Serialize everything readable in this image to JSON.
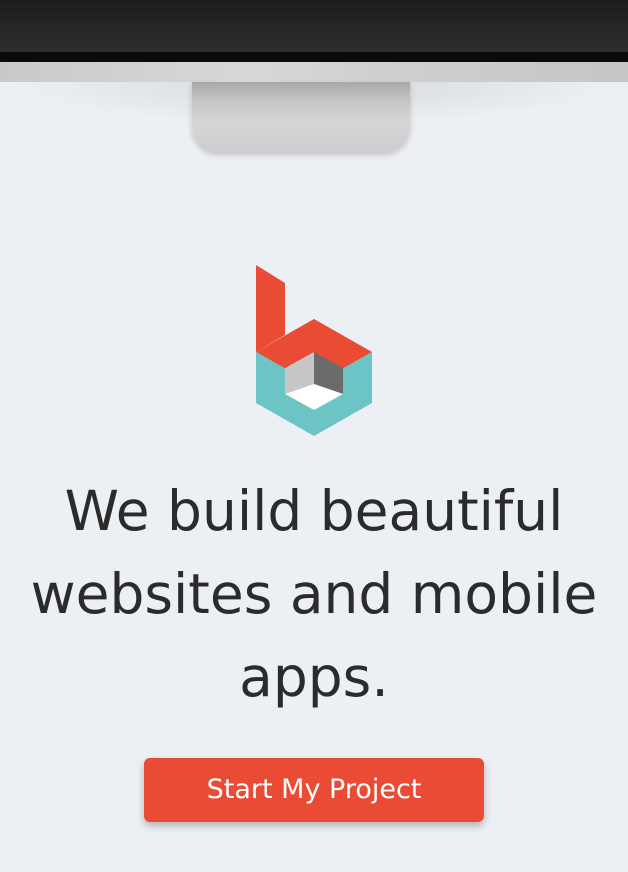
{
  "hero": {
    "headline": "We build beautiful websites and mobile apps.",
    "cta_label": "Start My Project"
  },
  "logo": {
    "icon": "b-cube-logo-icon",
    "colors": {
      "red": "#e94b35",
      "teal": "#6cc5c4",
      "grey_light": "#c7c7c7",
      "grey_dark": "#6b6b6b",
      "white": "#ffffff"
    }
  },
  "theme": {
    "background": "#eceff3",
    "accent": "#e94b35",
    "text": "#2b2b2b",
    "monitor_dark": "#1c1c1c",
    "monitor_silver": "#cfcfcf"
  }
}
